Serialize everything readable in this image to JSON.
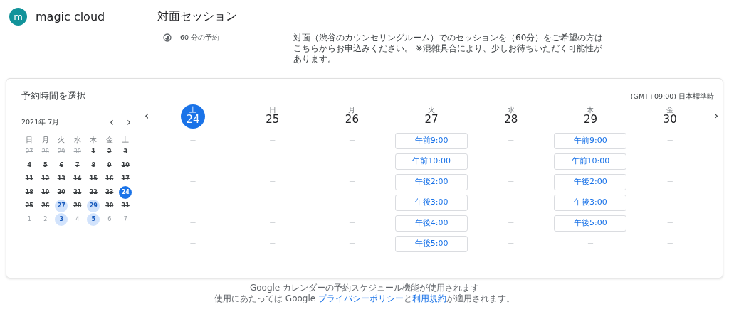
{
  "brand": {
    "initial": "m",
    "name": "magic cloud"
  },
  "event": {
    "title": "対面セッション",
    "duration": "60 分の予約",
    "description": "対面（渋谷のカウンセリングルーム）でのセッションを（60分）をご希望の方はこちらからお申込みください。 ※混雑具合により、少しお待ちいただく可能性があります。"
  },
  "booking": {
    "heading": "予約時間を選択",
    "timezone": "(GMT+09:00) 日本標準時",
    "mini_calendar": {
      "month": "2021年 7月",
      "prev": "‹",
      "next": "›",
      "weekdays": [
        "日",
        "月",
        "火",
        "水",
        "木",
        "金",
        "土"
      ],
      "days": [
        {
          "label": "27",
          "struck": true,
          "available": false,
          "selected": false,
          "outside": true
        },
        {
          "label": "28",
          "struck": true,
          "available": false,
          "selected": false,
          "outside": true
        },
        {
          "label": "29",
          "struck": true,
          "available": false,
          "selected": false,
          "outside": true
        },
        {
          "label": "30",
          "struck": true,
          "available": false,
          "selected": false,
          "outside": true
        },
        {
          "label": "1",
          "struck": true,
          "available": false,
          "selected": false,
          "outside": false
        },
        {
          "label": "2",
          "struck": true,
          "available": false,
          "selected": false,
          "outside": false
        },
        {
          "label": "3",
          "struck": true,
          "available": false,
          "selected": false,
          "outside": false
        },
        {
          "label": "4",
          "struck": true,
          "available": false,
          "selected": false,
          "outside": false
        },
        {
          "label": "5",
          "struck": true,
          "available": false,
          "selected": false,
          "outside": false
        },
        {
          "label": "6",
          "struck": true,
          "available": false,
          "selected": false,
          "outside": false
        },
        {
          "label": "7",
          "struck": true,
          "available": false,
          "selected": false,
          "outside": false
        },
        {
          "label": "8",
          "struck": true,
          "available": false,
          "selected": false,
          "outside": false
        },
        {
          "label": "9",
          "struck": true,
          "available": false,
          "selected": false,
          "outside": false
        },
        {
          "label": "10",
          "struck": true,
          "available": false,
          "selected": false,
          "outside": false
        },
        {
          "label": "11",
          "struck": true,
          "available": false,
          "selected": false,
          "outside": false
        },
        {
          "label": "12",
          "struck": true,
          "available": false,
          "selected": false,
          "outside": false
        },
        {
          "label": "13",
          "struck": true,
          "available": false,
          "selected": false,
          "outside": false
        },
        {
          "label": "14",
          "struck": true,
          "available": false,
          "selected": false,
          "outside": false
        },
        {
          "label": "15",
          "struck": true,
          "available": false,
          "selected": false,
          "outside": false
        },
        {
          "label": "16",
          "struck": true,
          "available": false,
          "selected": false,
          "outside": false
        },
        {
          "label": "17",
          "struck": true,
          "available": false,
          "selected": false,
          "outside": false
        },
        {
          "label": "18",
          "struck": true,
          "available": false,
          "selected": false,
          "outside": false
        },
        {
          "label": "19",
          "struck": true,
          "available": false,
          "selected": false,
          "outside": false
        },
        {
          "label": "20",
          "struck": true,
          "available": false,
          "selected": false,
          "outside": false
        },
        {
          "label": "21",
          "struck": true,
          "available": false,
          "selected": false,
          "outside": false
        },
        {
          "label": "22",
          "struck": true,
          "available": false,
          "selected": false,
          "outside": false
        },
        {
          "label": "23",
          "struck": true,
          "available": false,
          "selected": false,
          "outside": false
        },
        {
          "label": "24",
          "struck": false,
          "available": false,
          "selected": true,
          "outside": false
        },
        {
          "label": "25",
          "struck": true,
          "available": false,
          "selected": false,
          "outside": false
        },
        {
          "label": "26",
          "struck": true,
          "available": false,
          "selected": false,
          "outside": false
        },
        {
          "label": "27",
          "struck": false,
          "available": true,
          "selected": false,
          "outside": false
        },
        {
          "label": "28",
          "struck": true,
          "available": false,
          "selected": false,
          "outside": false
        },
        {
          "label": "29",
          "struck": false,
          "available": true,
          "selected": false,
          "outside": false
        },
        {
          "label": "30",
          "struck": true,
          "available": false,
          "selected": false,
          "outside": false
        },
        {
          "label": "31",
          "struck": true,
          "available": false,
          "selected": false,
          "outside": false
        },
        {
          "label": "1",
          "struck": false,
          "available": false,
          "selected": false,
          "outside": true
        },
        {
          "label": "2",
          "struck": false,
          "available": false,
          "selected": false,
          "outside": true
        },
        {
          "label": "3",
          "struck": false,
          "available": true,
          "selected": false,
          "outside": true
        },
        {
          "label": "4",
          "struck": false,
          "available": false,
          "selected": false,
          "outside": true
        },
        {
          "label": "5",
          "struck": false,
          "available": true,
          "selected": false,
          "outside": true
        },
        {
          "label": "6",
          "struck": false,
          "available": false,
          "selected": false,
          "outside": true
        },
        {
          "label": "7",
          "struck": false,
          "available": false,
          "selected": false,
          "outside": true
        }
      ]
    },
    "week_prev": "‹",
    "week_next": "›",
    "days": [
      {
        "weekday": "土",
        "date": "24",
        "selected": true,
        "slots": [
          {
            "kind": "empty",
            "label": "—"
          },
          {
            "kind": "empty",
            "label": "—"
          },
          {
            "kind": "empty",
            "label": "—"
          },
          {
            "kind": "empty",
            "label": "—"
          },
          {
            "kind": "empty",
            "label": "—"
          },
          {
            "kind": "empty",
            "label": "—"
          }
        ]
      },
      {
        "weekday": "日",
        "date": "25",
        "selected": false,
        "slots": [
          {
            "kind": "empty",
            "label": "—"
          },
          {
            "kind": "empty",
            "label": "—"
          },
          {
            "kind": "empty",
            "label": "—"
          },
          {
            "kind": "empty",
            "label": "—"
          },
          {
            "kind": "empty",
            "label": "—"
          },
          {
            "kind": "empty",
            "label": "—"
          }
        ]
      },
      {
        "weekday": "月",
        "date": "26",
        "selected": false,
        "slots": [
          {
            "kind": "empty",
            "label": "—"
          },
          {
            "kind": "empty",
            "label": "—"
          },
          {
            "kind": "empty",
            "label": "—"
          },
          {
            "kind": "empty",
            "label": "—"
          },
          {
            "kind": "empty",
            "label": "—"
          },
          {
            "kind": "empty",
            "label": "—"
          }
        ]
      },
      {
        "weekday": "火",
        "date": "27",
        "selected": false,
        "slots": [
          {
            "kind": "time",
            "label": "午前9:00"
          },
          {
            "kind": "time",
            "label": "午前10:00"
          },
          {
            "kind": "time",
            "label": "午後2:00"
          },
          {
            "kind": "time",
            "label": "午後3:00"
          },
          {
            "kind": "time",
            "label": "午後4:00"
          },
          {
            "kind": "time",
            "label": "午後5:00"
          }
        ]
      },
      {
        "weekday": "水",
        "date": "28",
        "selected": false,
        "slots": [
          {
            "kind": "empty",
            "label": "—"
          },
          {
            "kind": "empty",
            "label": "—"
          },
          {
            "kind": "empty",
            "label": "—"
          },
          {
            "kind": "empty",
            "label": "—"
          },
          {
            "kind": "empty",
            "label": "—"
          },
          {
            "kind": "empty",
            "label": "—"
          }
        ]
      },
      {
        "weekday": "木",
        "date": "29",
        "selected": false,
        "slots": [
          {
            "kind": "time",
            "label": "午前9:00"
          },
          {
            "kind": "time",
            "label": "午前10:00"
          },
          {
            "kind": "time",
            "label": "午後2:00"
          },
          {
            "kind": "time",
            "label": "午後3:00"
          },
          {
            "kind": "time",
            "label": "午後5:00"
          },
          {
            "kind": "empty",
            "label": "—"
          }
        ]
      },
      {
        "weekday": "金",
        "date": "30",
        "selected": false,
        "slots": [
          {
            "kind": "empty",
            "label": "—"
          },
          {
            "kind": "empty",
            "label": "—"
          },
          {
            "kind": "empty",
            "label": "—"
          },
          {
            "kind": "empty",
            "label": "—"
          },
          {
            "kind": "empty",
            "label": "—"
          },
          {
            "kind": "empty",
            "label": "—"
          }
        ]
      }
    ]
  },
  "footer": {
    "line1": "Google カレンダーの予約スケジュール機能が使用されます",
    "line2_before": "使用にあたっては Google ",
    "privacy": "プライバシーポリシー",
    "and": "と",
    "terms": "利用規約",
    "line2_after": "が適用されます。"
  }
}
